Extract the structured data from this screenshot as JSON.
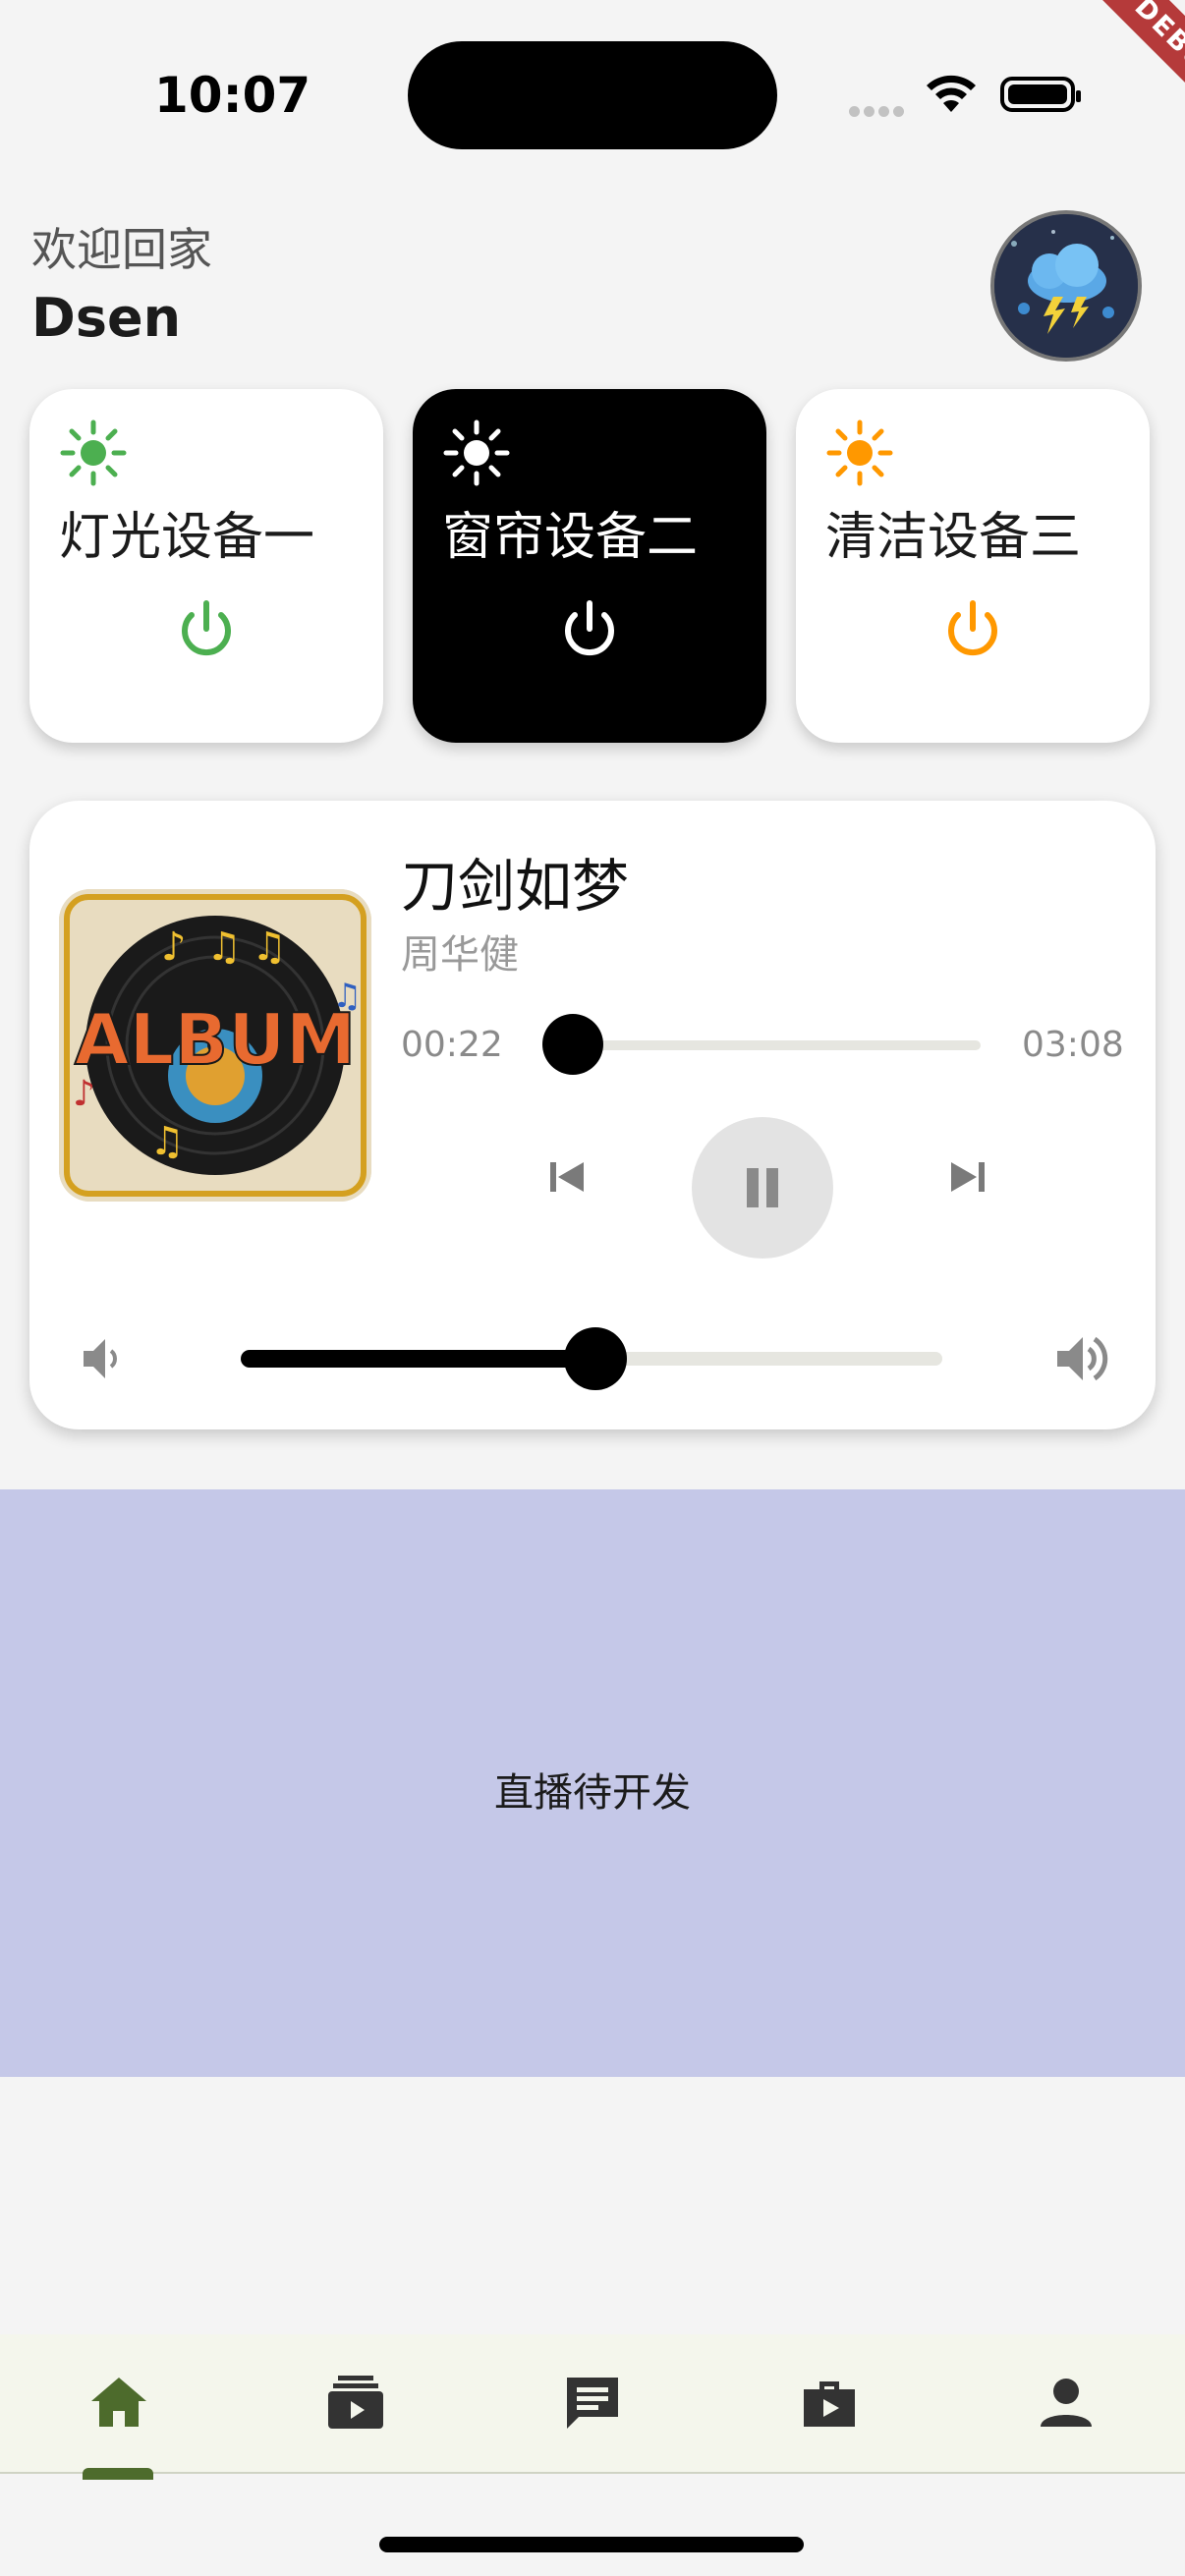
{
  "status_bar": {
    "time": "10:07",
    "ribbon": "DEBUG"
  },
  "header": {
    "greeting": "欢迎回家",
    "username": "Dsen",
    "avatar_icon": "storm-cloud-avatar"
  },
  "devices": [
    {
      "name": "灯光设备一",
      "icon": "sun-icon",
      "power": "power-icon",
      "accent": "#4caf50",
      "bg": "#ffffff",
      "fg": "#1b1b1b",
      "active": false
    },
    {
      "name": "窗帘设备二",
      "icon": "sun-icon",
      "power": "power-icon",
      "accent": "#ffffff",
      "bg": "#000000",
      "fg": "#ffffff",
      "active": true
    },
    {
      "name": "清洁设备三",
      "icon": "sun-icon",
      "power": "power-icon",
      "accent": "#ff9800",
      "bg": "#ffffff",
      "fg": "#1b1b1b",
      "active": false
    }
  ],
  "player": {
    "title": "刀剑如梦",
    "artist": "周华健",
    "current_time": "00:22",
    "total_time": "03:08",
    "volume_fraction": 0.5,
    "album_label": "ALBUM"
  },
  "live": {
    "text": "直播待开发"
  },
  "nav": {
    "items": [
      "home-icon",
      "subscriptions-icon",
      "chat-icon",
      "work-play-icon",
      "person-icon"
    ],
    "selected": 0,
    "accent": "#4d6b2c"
  }
}
